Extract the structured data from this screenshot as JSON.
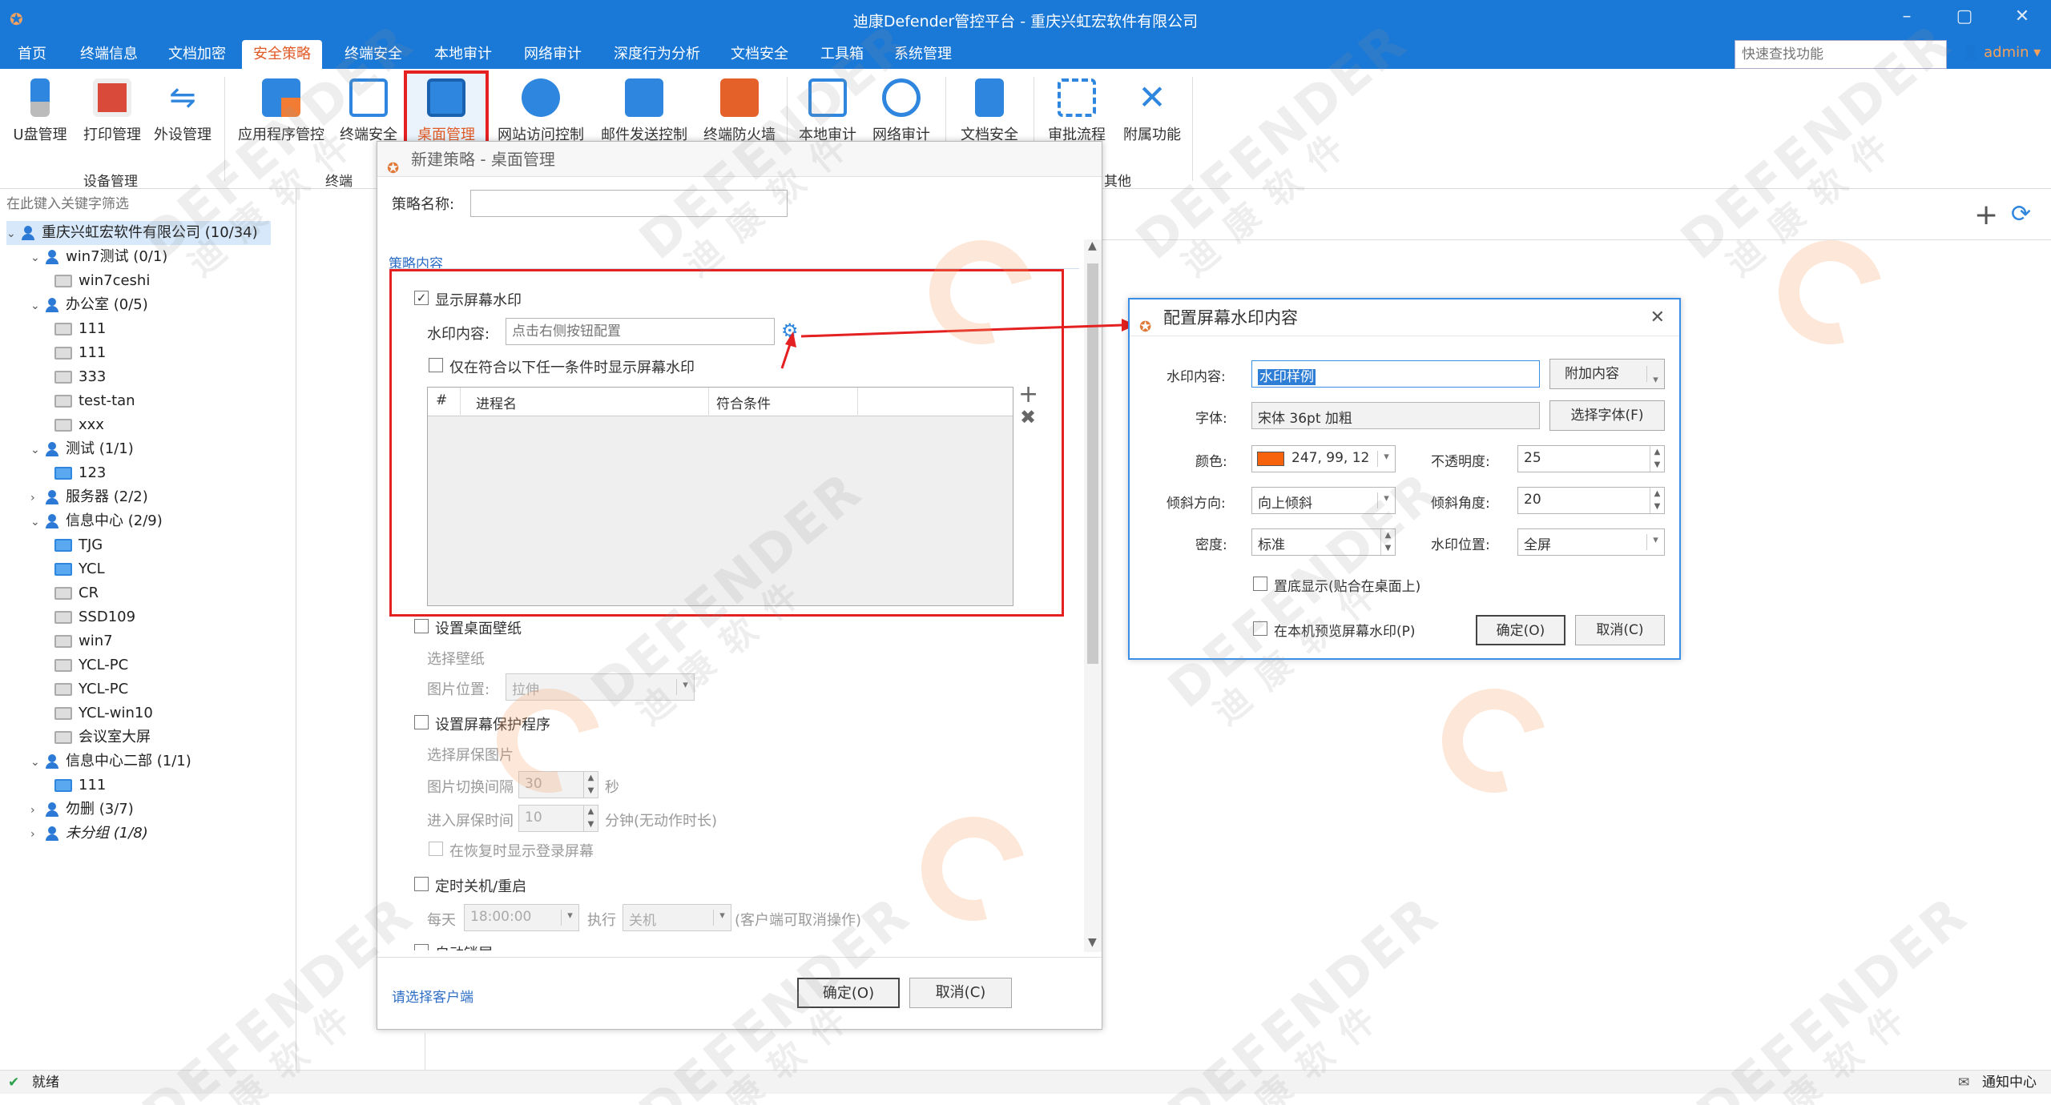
{
  "window": {
    "title": "迪康Defender管控平台 - 重庆兴虹宏软件有限公司"
  },
  "menu": {
    "items": [
      "首页",
      "终端信息",
      "文档加密",
      "安全策略",
      "终端安全",
      "本地审计",
      "网络审计",
      "深度行为分析",
      "文档安全",
      "工具箱",
      "系统管理"
    ],
    "active": "安全策略",
    "quick_search_placeholder": "快速查找功能",
    "user": "admin"
  },
  "ribbon": {
    "buttons": [
      "U盘管理",
      "打印管理",
      "外设管理",
      "应用程序管控",
      "终端安全",
      "桌面管理",
      "网站访问控制",
      "邮件发送控制",
      "终端防火墙",
      "本地审计",
      "网络审计",
      "文档安全",
      "审批流程",
      "附属功能"
    ],
    "groups": [
      "设备管理",
      "终端",
      "其他"
    ]
  },
  "tree": {
    "filter_placeholder": "在此键入关键字筛选",
    "nodes": [
      {
        "label": "重庆兴虹宏软件有限公司 (10/34)",
        "type": "group",
        "arrow": "⌄"
      },
      {
        "label": "win7测试 (0/1)",
        "type": "group",
        "arrow": "⌄"
      },
      {
        "label": "win7ceshi",
        "type": "pc"
      },
      {
        "label": "办公室 (0/5)",
        "type": "group",
        "arrow": "⌄"
      },
      {
        "label": "111",
        "type": "pc"
      },
      {
        "label": "111",
        "type": "pc"
      },
      {
        "label": "333",
        "type": "pc"
      },
      {
        "label": "test-tan",
        "type": "pc"
      },
      {
        "label": "xxx",
        "type": "pc"
      },
      {
        "label": "测试 (1/1)",
        "type": "group",
        "arrow": "⌄"
      },
      {
        "label": "123",
        "type": "pc-on"
      },
      {
        "label": "服务器 (2/2)",
        "type": "group",
        "arrow": "›"
      },
      {
        "label": "信息中心 (2/9)",
        "type": "group",
        "arrow": "⌄"
      },
      {
        "label": "TJG",
        "type": "pc-on"
      },
      {
        "label": "YCL",
        "type": "pc-on"
      },
      {
        "label": "CR",
        "type": "pc"
      },
      {
        "label": "SSD109",
        "type": "pc"
      },
      {
        "label": "win7",
        "type": "pc"
      },
      {
        "label": "YCL-PC",
        "type": "pc"
      },
      {
        "label": "YCL-PC",
        "type": "pc"
      },
      {
        "label": "YCL-win10",
        "type": "pc"
      },
      {
        "label": "会议室大屏",
        "type": "pc"
      },
      {
        "label": "信息中心二部 (1/1)",
        "type": "group",
        "arrow": "⌄"
      },
      {
        "label": "111",
        "type": "pc-on"
      },
      {
        "label": "勿删 (3/7)",
        "type": "group",
        "arrow": "›"
      },
      {
        "label": "未分组 (1/8)",
        "type": "group",
        "arrow": "›"
      }
    ]
  },
  "status": {
    "text": "就绪",
    "notify": "通知中心"
  },
  "policy_dialog": {
    "title": "新建策略 - 桌面管理",
    "name_label": "策略名称:",
    "name_value": "",
    "section": "策略内容",
    "show_watermark": "显示屏幕水印",
    "watermark_content_label": "水印内容:",
    "watermark_content_placeholder": "点击右侧按钮配置",
    "only_condition": "仅在符合以下任一条件时显示屏幕水印",
    "table_headers": [
      "#",
      "进程名",
      "符合条件"
    ],
    "wallpaper": "设置桌面壁纸",
    "select_wallpaper": "选择壁纸",
    "pic_position_label": "图片位置:",
    "pic_position_value": "拉伸",
    "screensaver": "设置屏幕保护程序",
    "select_saver_pic": "选择屏保图片",
    "pic_interval_label": "图片切换间隔",
    "pic_interval_value": "30",
    "pic_interval_unit": "秒",
    "saver_time_label": "进入屏保时间",
    "saver_time_value": "10",
    "saver_time_unit": "分钟(无动作时长)",
    "show_login_on_restore": "在恢复时显示登录屏幕",
    "scheduled": "定时关机/重启",
    "daily_label": "每天",
    "daily_time": "18:00:00",
    "execute_label": "执行",
    "execute_value": "关机",
    "cancel_note": "(客户端可取消操作)",
    "auto_lock": "自动锁屏",
    "select_client": "请选择客户端",
    "ok": "确定(O)",
    "cancel": "取消(C)"
  },
  "watermark_dialog": {
    "title": "配置屏幕水印内容",
    "content_label": "水印内容:",
    "content_value": "水印样例",
    "append_btn": "附加内容",
    "font_label": "字体:",
    "font_value": "宋体 36pt 加粗",
    "font_btn": "选择字体(F)",
    "color_label": "颜色:",
    "color_value": "247, 99, 12",
    "color_hex": "#f7630c",
    "opacity_label": "不透明度:",
    "opacity_value": "25",
    "tilt_dir_label": "倾斜方向:",
    "tilt_dir_value": "向上倾斜",
    "tilt_angle_label": "倾斜角度:",
    "tilt_angle_value": "20",
    "density_label": "密度:",
    "density_value": "标准",
    "position_label": "水印位置:",
    "position_value": "全屏",
    "bottom_display": "置底显示(贴合在桌面上)",
    "preview": "在本机预览屏幕水印(P)",
    "ok": "确定(O)",
    "cancel": "取消(C)"
  },
  "watermark_overlay": {
    "brand": "DEFENDER",
    "cn1": "迪",
    "cn2": "康",
    "cn3": "软",
    "cn4": "件"
  },
  "colors": {
    "titlebar": "#1a78d6",
    "accent": "#e05a26",
    "highlight": "#e42020"
  }
}
